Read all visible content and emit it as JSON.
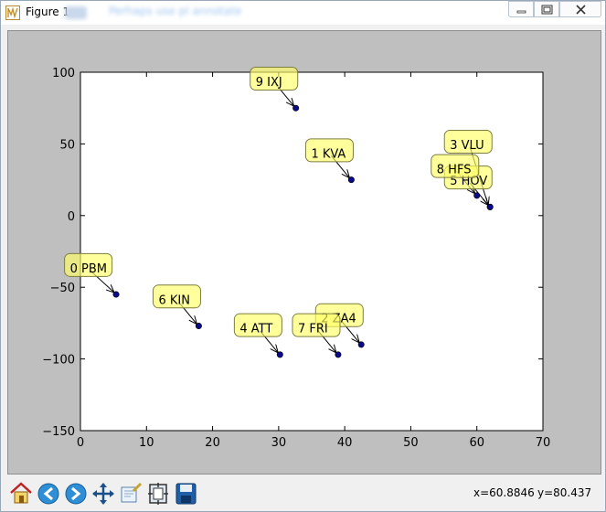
{
  "window": {
    "title": "Figure 1",
    "blurred_caption": "Perhaps use pl annotate"
  },
  "toolbar": {
    "buttons": [
      {
        "name": "home-button",
        "icon": "home-icon"
      },
      {
        "name": "back-button",
        "icon": "arrow-left-icon"
      },
      {
        "name": "forward-button",
        "icon": "arrow-right-icon"
      },
      {
        "name": "pan-button",
        "icon": "move-arrows-icon"
      },
      {
        "name": "zoom-button",
        "icon": "zoom-rect-icon"
      },
      {
        "name": "subplots-button",
        "icon": "configure-subplots-icon"
      },
      {
        "name": "save-button",
        "icon": "floppy-disk-icon"
      }
    ],
    "coord_x": "x=60.8846",
    "coord_y": "y=80.437"
  },
  "colors": {
    "figure_bg": "#bfbfbf",
    "axes_bg": "#ffffff",
    "point": "#0a0a8a",
    "annotation_fill": "#ffff66",
    "annotation_border": "#7d7d40"
  },
  "chart_data": {
    "type": "scatter",
    "title": "",
    "xlabel": "",
    "ylabel": "",
    "xlim": [
      0,
      70
    ],
    "ylim": [
      -150,
      100
    ],
    "xticks": [
      0,
      10,
      20,
      30,
      40,
      50,
      60,
      70
    ],
    "yticks": [
      100,
      50,
      0,
      -50,
      -100,
      -150
    ],
    "xtick_labels": [
      "0",
      "10",
      "20",
      "30",
      "40",
      "50",
      "60",
      "70"
    ],
    "ytick_labels": [
      "100",
      "50",
      "0",
      "−50",
      "−100",
      "−150"
    ],
    "grid": false,
    "points": [
      {
        "label": "0 PBM",
        "x": 5.4,
        "y": -55,
        "label_x": -1.3,
        "label_y": -37
      },
      {
        "label": "1 KVA",
        "x": 41.0,
        "y": 25,
        "label_x": 35.2,
        "label_y": 43
      },
      {
        "label": "2 ZA4",
        "x": 42.5,
        "y": -90,
        "label_x": 36.7,
        "label_y": -72
      },
      {
        "label": "3 VLU",
        "x": 62.0,
        "y": 6,
        "label_x": 56.2,
        "label_y": 49
      },
      {
        "label": "4 ATT",
        "x": 30.2,
        "y": -97,
        "label_x": 24.4,
        "label_y": -79
      },
      {
        "label": "5 HOV",
        "x": 62.0,
        "y": 6,
        "label_x": 56.2,
        "label_y": 24
      },
      {
        "label": "6 KIN",
        "x": 17.9,
        "y": -77,
        "label_x": 12.1,
        "label_y": -59
      },
      {
        "label": "7 FRI",
        "x": 39.0,
        "y": -97,
        "label_x": 33.2,
        "label_y": -79
      },
      {
        "label": "8 HFS",
        "x": 60.0,
        "y": 14,
        "label_x": 54.2,
        "label_y": 32
      },
      {
        "label": "9 IXJ",
        "x": 32.6,
        "y": 75,
        "label_x": 26.8,
        "label_y": 93
      }
    ]
  }
}
